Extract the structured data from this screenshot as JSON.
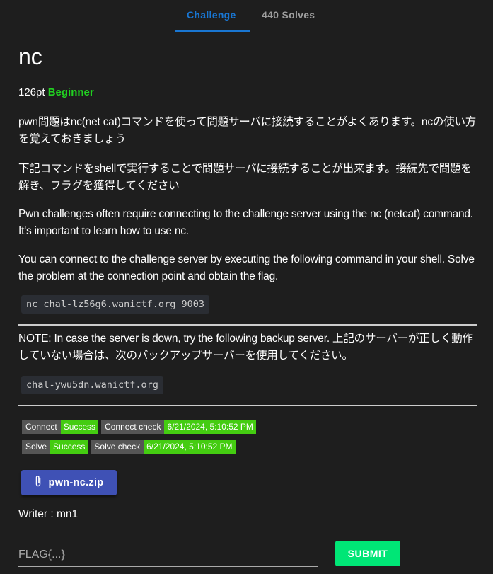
{
  "tabs": [
    {
      "label": "Challenge",
      "active": true
    },
    {
      "label": "440 Solves",
      "active": false
    }
  ],
  "challenge": {
    "title": "nc",
    "points": "126pt",
    "difficulty": "Beginner",
    "difficulty_color": "#21d121",
    "paragraphs": [
      "pwn問題はnc(net cat)コマンドを使って問題サーバに接続することがよくあります。ncの使い方を覚えておきましょう",
      "下記コマンドをshellで実行することで問題サーバに接続することが出来ます。接続先で問題を解き、フラグを獲得してください",
      "Pwn challenges often require connecting to the challenge server using the nc (netcat) command. It's important to learn how to use nc.",
      "You can connect to the challenge server by executing the following command in your shell. Solve the problem at the connection point and obtain the flag."
    ],
    "command": "nc chal-lz56g6.wanictf.org 9003",
    "note": "NOTE: In case the server is down, try the following backup server. 上記のサーバーが正しく動作していない場合は、次のバックアップサーバーを使用してください。",
    "backup_server": "chal-ywu5dn.wanictf.org"
  },
  "badges": [
    [
      {
        "key": "Connect",
        "value": "Success"
      },
      {
        "key": "Connect check",
        "value": "6/21/2024, 5:10:52 PM"
      }
    ],
    [
      {
        "key": "Solve",
        "value": "Success"
      },
      {
        "key": "Solve check",
        "value": "6/21/2024, 5:10:52 PM"
      }
    ]
  ],
  "attachment": {
    "label": "pwn-nc.zip",
    "icon": "paperclip-icon"
  },
  "writer": "Writer : mn1",
  "flag_input": {
    "placeholder": "FLAG{...}",
    "value": ""
  },
  "submit_label": "SUBMIT",
  "colors": {
    "accent": "#1976d2",
    "success": "#44cc11",
    "file_button": "#3f51b5",
    "submit": "#00e676"
  }
}
